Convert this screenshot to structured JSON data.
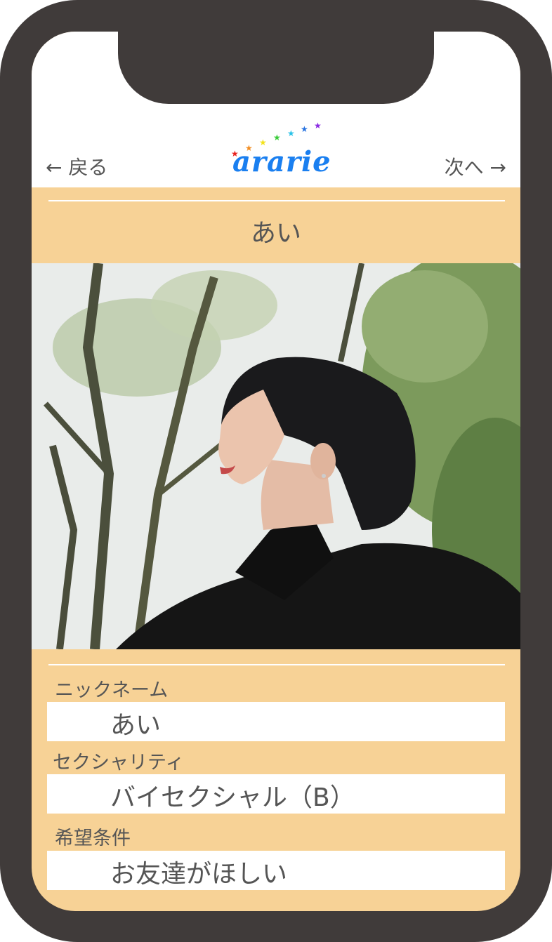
{
  "nav": {
    "back_label": "← 戻る",
    "next_label": "次へ →"
  },
  "logo": {
    "text": "ararie",
    "stars": [
      "#e8231f",
      "#f28d21",
      "#f3e21b",
      "#3bcc3b",
      "#29c2e8",
      "#2672e0",
      "#8a2be2"
    ]
  },
  "profile": {
    "name": "あい",
    "photo_alt": "",
    "fields": [
      {
        "label": "ニックネーム",
        "value": "あい"
      },
      {
        "label": "セクシャリティ",
        "value": "バイセクシャル（B）"
      },
      {
        "label": "希望条件",
        "value": "お友達がほしい"
      }
    ]
  },
  "colors": {
    "accent": "#f7d296",
    "frame": "#403b3a",
    "logo": "#1a7ff0"
  }
}
